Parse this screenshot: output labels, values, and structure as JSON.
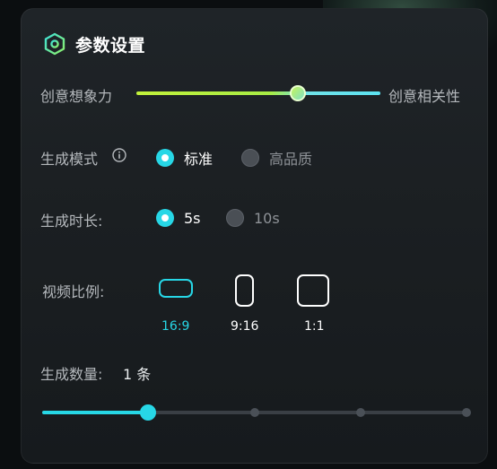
{
  "panel": {
    "title": "参数设置",
    "title_icon": "hexagon-settings-icon"
  },
  "creativity": {
    "left_label": "创意想象力",
    "right_label": "创意相关性",
    "value_fraction": 0.66,
    "gradient_colors": [
      "#c2f23b",
      "#5ce3f2"
    ]
  },
  "mode": {
    "label": "生成模式",
    "info_icon": "info-circle-icon",
    "options": [
      {
        "label": "标准",
        "selected": true
      },
      {
        "label": "高品质",
        "selected": false
      }
    ]
  },
  "duration": {
    "label": "生成时长:",
    "options": [
      {
        "label": "5s",
        "selected": true
      },
      {
        "label": "10s",
        "selected": false
      }
    ]
  },
  "ratio": {
    "label": "视频比例:",
    "options": [
      {
        "label": "16:9",
        "selected": true,
        "icon": "landscape-frame-icon"
      },
      {
        "label": "9:16",
        "selected": false,
        "icon": "portrait-frame-icon"
      },
      {
        "label": "1:1",
        "selected": false,
        "icon": "square-frame-icon"
      }
    ]
  },
  "quantity": {
    "label": "生成数量:",
    "value_text": "1 条",
    "value": 1,
    "min": 0,
    "max": 4,
    "thumb_position_fraction": 0.25
  },
  "colors": {
    "accent": "#27d7e6",
    "panel_bg": "#1c2023"
  }
}
